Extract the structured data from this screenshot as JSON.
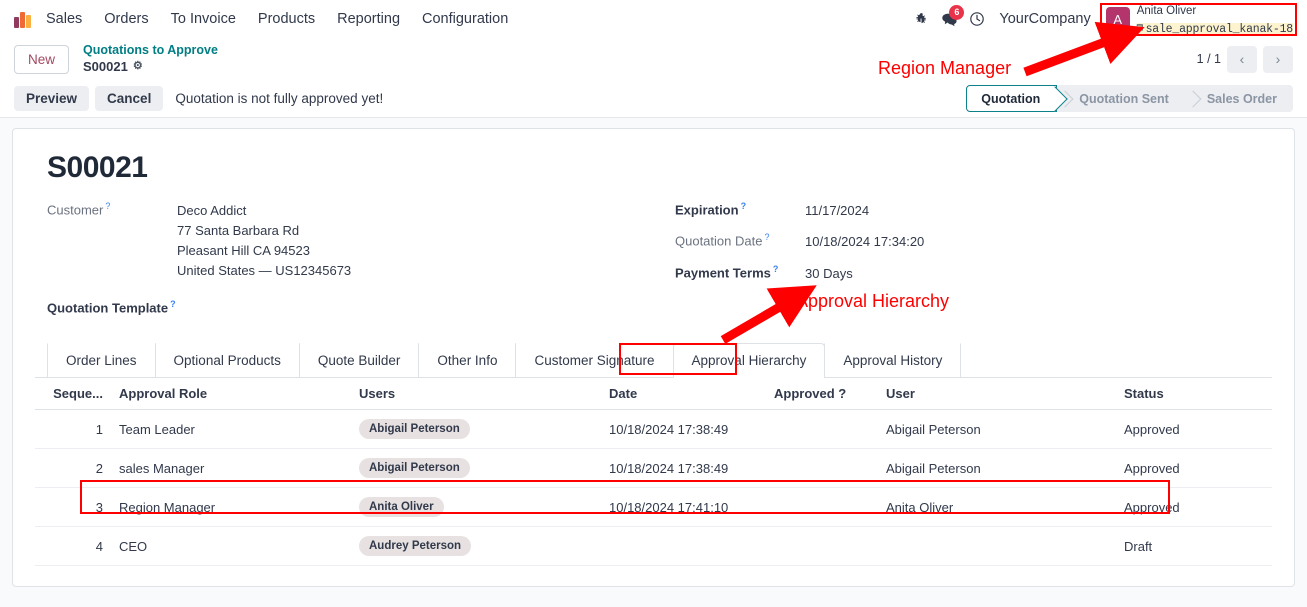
{
  "navbar": {
    "brand": "Sales",
    "menus": [
      "Orders",
      "To Invoice",
      "Products",
      "Reporting",
      "Configuration"
    ],
    "icons": {
      "bug": "bug-icon",
      "messages": "messages-icon",
      "activity": "clock-icon"
    },
    "message_count": "6",
    "company": "YourCompany",
    "user": {
      "initial": "A",
      "name": "Anita Oliver",
      "database": "sale_approval_kanak-18",
      "avatar_color": "#b3356b",
      "db_highlight": "#fdf4cf"
    }
  },
  "breadcrumb": {
    "new_label": "New",
    "parent": "Quotations to Approve",
    "current": "S00021",
    "gear": "⚙",
    "pager": {
      "count": "1 / 1",
      "prev": "‹",
      "next": "›"
    }
  },
  "controls": {
    "preview_label": "Preview",
    "cancel_label": "Cancel",
    "note": "Quotation is not fully approved yet!",
    "statusbar": [
      {
        "label": "Quotation",
        "active": true
      },
      {
        "label": "Quotation Sent",
        "active": false
      },
      {
        "label": "Sales Order",
        "active": false
      }
    ]
  },
  "record": {
    "title": "S00021",
    "left": {
      "customer_label": "Customer",
      "customer_name": "Deco Addict",
      "customer_address": [
        "77 Santa Barbara Rd",
        "Pleasant Hill CA 94523",
        "United States — US12345673"
      ],
      "quotation_template_label": "Quotation Template",
      "quotation_template_value": ""
    },
    "right": {
      "expiration_label": "Expiration",
      "expiration_value": "11/17/2024",
      "quotation_date_label": "Quotation Date",
      "quotation_date_value": "10/18/2024 17:34:20",
      "payment_terms_label": "Payment Terms",
      "payment_terms_value": "30 Days"
    }
  },
  "notebook": {
    "tabs": [
      {
        "label": "Order Lines",
        "active": false
      },
      {
        "label": "Optional Products",
        "active": false
      },
      {
        "label": "Quote Builder",
        "active": false
      },
      {
        "label": "Other Info",
        "active": false
      },
      {
        "label": "Customer Signature",
        "active": false
      },
      {
        "label": "Approval Hierarchy",
        "active": true
      },
      {
        "label": "Approval History",
        "active": false
      }
    ]
  },
  "table": {
    "headers": [
      "Seque...",
      "Approval Role",
      "Users",
      "Date",
      "Approved ?",
      "User",
      "Status"
    ],
    "rows": [
      {
        "sequence": "1",
        "role": "Team Leader",
        "users": "Abigail Peterson",
        "date": "10/18/2024 17:38:49",
        "approved": "",
        "user": "Abigail Peterson",
        "status": "Approved"
      },
      {
        "sequence": "2",
        "role": "sales Manager",
        "users": "Abigail Peterson",
        "date": "10/18/2024 17:38:49",
        "approved": "",
        "user": "Abigail Peterson",
        "status": "Approved"
      },
      {
        "sequence": "3",
        "role": "Region Manager",
        "users": "Anita Oliver",
        "date": "10/18/2024 17:41:10",
        "approved": "",
        "user": "Anita Oliver",
        "status": "Approved"
      },
      {
        "sequence": "4",
        "role": "CEO",
        "users": "Audrey Peterson",
        "date": "",
        "approved": "",
        "user": "",
        "status": "Draft"
      }
    ]
  },
  "annotations": {
    "color": "#ff0000",
    "region_manager_label": "Region Manager",
    "approval_hierarchy_label": "Approval Hierarchy"
  }
}
